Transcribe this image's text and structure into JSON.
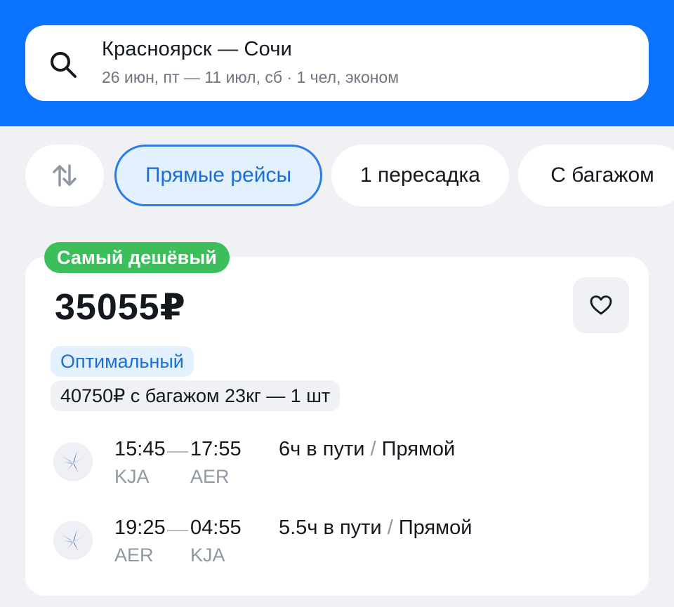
{
  "search": {
    "route": "Красноярск — Сочи",
    "details": "26 июн, пт — 11 июл, сб · 1 чел, эконом"
  },
  "filters": [
    {
      "label": "Прямые рейсы",
      "active": true
    },
    {
      "label": "1 пересадка",
      "active": false
    },
    {
      "label": "С багажом",
      "active": false
    }
  ],
  "offer": {
    "badge": "Самый дешёвый",
    "price": "35055₽",
    "tag": "Оптимальный",
    "baggage_option": "40750₽ с багажом 23кг — 1 шт",
    "segments": [
      {
        "dep_time": "15:45",
        "arr_time": "17:55",
        "dep_code": "KJA",
        "arr_code": "AER",
        "duration": "6ч в пути",
        "sep": "/",
        "type": "Прямой"
      },
      {
        "dep_time": "19:25",
        "arr_time": "04:55",
        "dep_code": "AER",
        "arr_code": "KJA",
        "duration": "5.5ч в пути",
        "sep": "/",
        "type": "Прямой"
      }
    ]
  },
  "colors": {
    "brand": "#0c73fe",
    "active_chip_border": "#2a7de8",
    "badge_green": "#3cbf5a"
  },
  "icons": [
    "search-icon",
    "sort-icon",
    "heart-icon",
    "airline-logo-icon"
  ]
}
